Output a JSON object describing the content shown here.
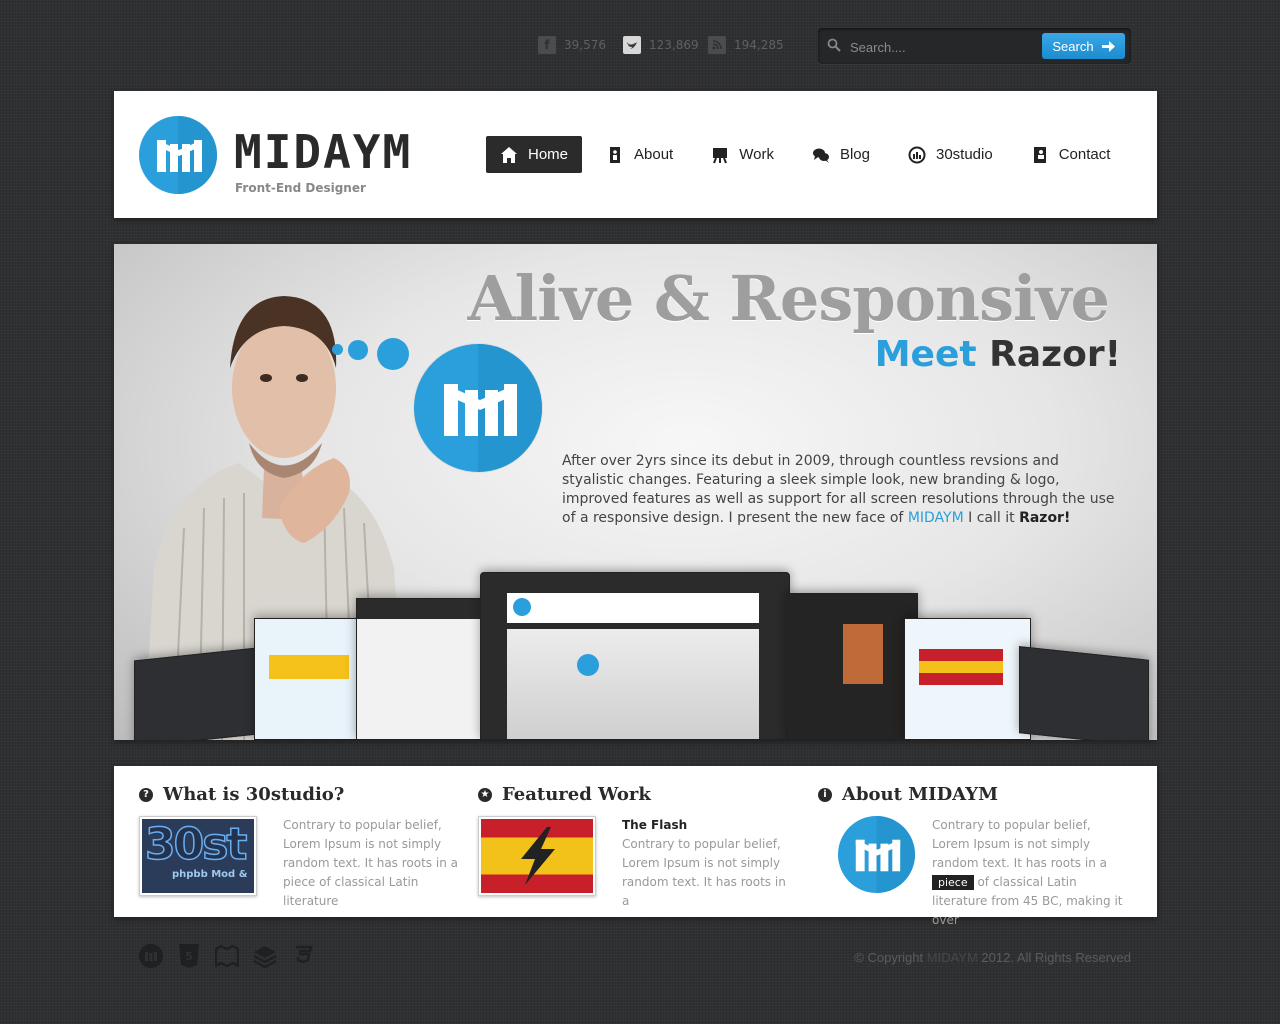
{
  "social": [
    {
      "icon": "facebook-icon",
      "glyph": "f",
      "count": "39,576"
    },
    {
      "icon": "twitter-icon",
      "glyph": "t",
      "count": "123,869"
    },
    {
      "icon": "rss-icon",
      "glyph": "",
      "count": "194,285"
    }
  ],
  "search": {
    "placeholder": "Search....",
    "button_label": "Search"
  },
  "header": {
    "brand": "MIDAYM",
    "tagline": "Front-End Designer",
    "nav": [
      {
        "label": "Home",
        "icon": "home-icon",
        "active": true
      },
      {
        "label": "About",
        "icon": "document-icon"
      },
      {
        "label": "Work",
        "icon": "easel-icon"
      },
      {
        "label": "Blog",
        "icon": "chat-bubbles-icon"
      },
      {
        "label": "30studio",
        "icon": "gauge-icon"
      },
      {
        "label": "Contact",
        "icon": "contact-card-icon"
      }
    ]
  },
  "hero": {
    "title": "Alive & Responsive",
    "sub_blue": "Meet",
    "sub_dark": "Razor!",
    "text_1": "After over 2yrs since its debut in 2009, through countless revsions and styalistic changes. Featuring a sleek simple look, new branding & logo, improved features as well as support for all screen resolutions through the use of a responsive design. I present the new face of ",
    "text_link": "MIDAYM",
    "text_2": " I call it ",
    "text_bold": "Razor!"
  },
  "info": {
    "col1": {
      "title": "What is 30studio?",
      "icon": "question-icon",
      "text": "Contrary to popular belief, Lorem Ipsum is not simply random text. It has roots in a piece of classical Latin literature",
      "thumb_text": "30st",
      "thumb_sub": "phpbb Mod &"
    },
    "col2": {
      "title": "Featured Work",
      "icon": "star-icon",
      "heading": "The Flash",
      "text": "Contrary to popular belief, Lorem Ipsum is not simply random text. It has roots in a"
    },
    "col3": {
      "title": "About MIDAYM",
      "icon": "info-icon",
      "text_1": "Contrary to popular belief, Lorem Ipsum is not simply random text. It has roots in a ",
      "tooltip": "piece",
      "text_2": " of classical Latin literature from 45 BC, making it over"
    }
  },
  "footer": {
    "icons": [
      "midaym-logo-icon",
      "html5-icon",
      "book-icon",
      "layers-icon",
      "css3-icon"
    ],
    "copyright_prefix": "© Copyright ",
    "copyright_brand": "MIDAYM",
    "copyright_suffix": " 2012. All Rights Reserved"
  },
  "colors": {
    "accent": "#2a9fdc",
    "background": "#2f3032",
    "dark": "#2b2b2b"
  }
}
